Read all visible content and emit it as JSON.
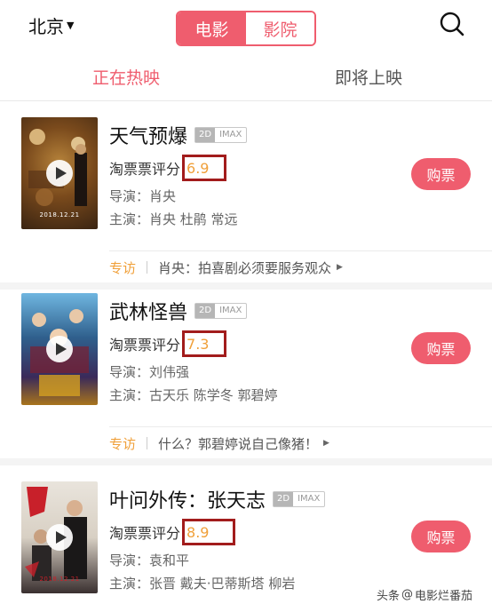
{
  "header": {
    "city": "北京",
    "segments": [
      "电影",
      "影院"
    ]
  },
  "tabs": [
    "正在热映",
    "即将上映"
  ],
  "movies": [
    {
      "title": "天气预爆",
      "format_2d": "2D",
      "format_imax": "IMAX",
      "score_label": "淘票票评分",
      "score": "6.9",
      "director_label": "导演：",
      "director": "肖央",
      "cast_label": "主演：",
      "cast": "肖央 杜鹃 常远",
      "buy": "购票",
      "poster_date": "2018.12.21",
      "interview_tag": "专访",
      "interview_text": "肖央：拍喜剧必须要服务观众"
    },
    {
      "title": "武林怪兽",
      "format_2d": "2D",
      "format_imax": "IMAX",
      "score_label": "淘票票评分",
      "score": "7.3",
      "director_label": "导演：",
      "director": "刘伟强",
      "cast_label": "主演：",
      "cast": "古天乐 陈学冬 郭碧婷",
      "buy": "购票",
      "poster_date": "",
      "interview_tag": "专访",
      "interview_text": "什么？郭碧婷说自己像猪！"
    },
    {
      "title": "叶问外传：张天志",
      "format_2d": "2D",
      "format_imax": "IMAX",
      "score_label": "淘票票评分",
      "score": "8.9",
      "director_label": "导演：",
      "director": "袁和平",
      "cast_label": "主演：",
      "cast": "张晋 戴夫·巴蒂斯塔 柳岩",
      "buy": "购票",
      "poster_date": "2018.12.21"
    }
  ],
  "watermark": {
    "prefix": "头条",
    "at": "@",
    "name": "电影烂番茄"
  },
  "colors": {
    "accent": "#ef5d6e",
    "score": "#f0a03a",
    "highlight_box": "#a21c1c"
  }
}
